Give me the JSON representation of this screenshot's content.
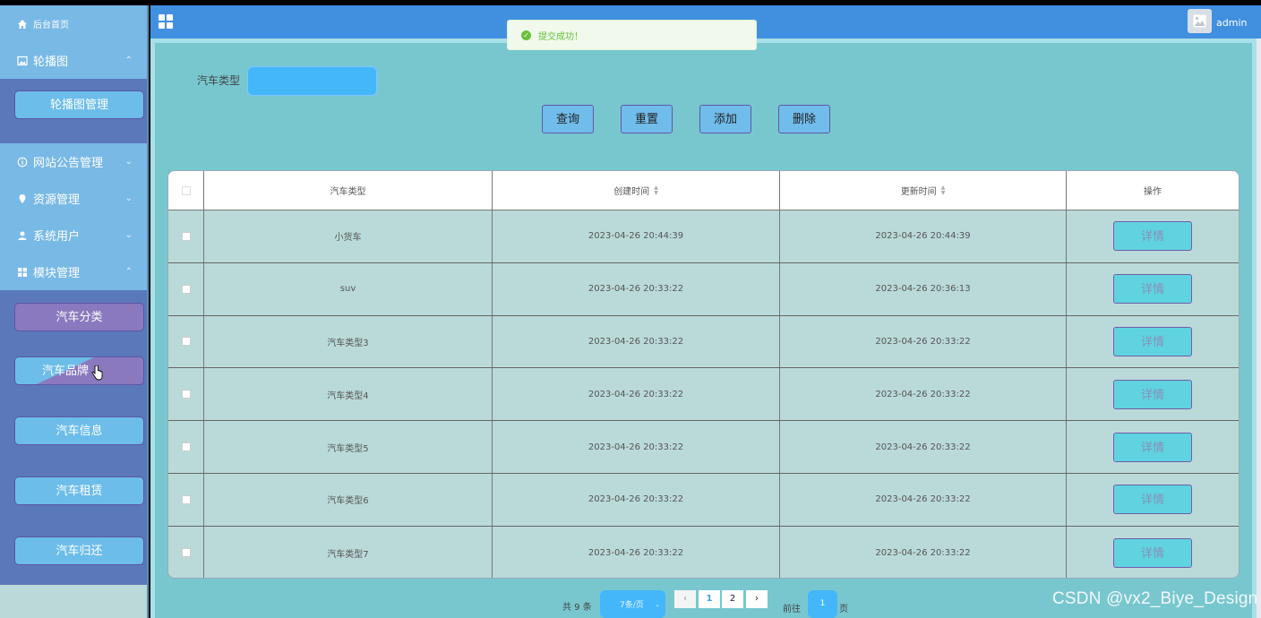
{
  "sidebar": {
    "home": "后台首页",
    "carousel": "轮播图",
    "carousel_manage": "轮播图管理",
    "notice": "网站公告管理",
    "resource": "资源管理",
    "users": "系统用户",
    "modules": "模块管理",
    "module_items": [
      "汽车分类",
      "汽车品牌",
      "汽车信息",
      "汽车租赁",
      "汽车归还"
    ]
  },
  "header": {
    "title": "",
    "user": "admin"
  },
  "toast": {
    "message": "提交成功！"
  },
  "filter": {
    "label": "汽车类型",
    "value": ""
  },
  "actions": {
    "query": "查询",
    "reset": "重置",
    "add": "添加",
    "delete": "删除"
  },
  "table": {
    "columns": [
      "汽车类型",
      "创建时间",
      "更新时间",
      "操作"
    ],
    "rows": [
      {
        "type": "小货车",
        "created": "2023-04-26 20:44:39",
        "updated": "2023-04-26 20:44:39",
        "action": "详情"
      },
      {
        "type": "suv",
        "created": "2023-04-26 20:33:22",
        "updated": "2023-04-26 20:36:13",
        "action": "详情"
      },
      {
        "type": "汽车类型3",
        "created": "2023-04-26 20:33:22",
        "updated": "2023-04-26 20:33:22",
        "action": "详情"
      },
      {
        "type": "汽车类型4",
        "created": "2023-04-26 20:33:22",
        "updated": "2023-04-26 20:33:22",
        "action": "详情"
      },
      {
        "type": "汽车类型5",
        "created": "2023-04-26 20:33:22",
        "updated": "2023-04-26 20:33:22",
        "action": "详情"
      },
      {
        "type": "汽车类型6",
        "created": "2023-04-26 20:33:22",
        "updated": "2023-04-26 20:33:22",
        "action": "详情"
      },
      {
        "type": "汽车类型7",
        "created": "2023-04-26 20:33:22",
        "updated": "2023-04-26 20:33:22",
        "action": "详情"
      }
    ]
  },
  "pagination": {
    "total": "共 9 条",
    "page_size": "7条/页",
    "pages": [
      "1",
      "2"
    ],
    "current": "1",
    "goto_label": "前往",
    "goto_value": "1",
    "goto_suffix": "页"
  },
  "watermark": "CSDN @vx2_Biye_Design",
  "colors": {
    "topbar": "#4190e0",
    "sidebar_top": "#79b9e6",
    "sidebar_sub": "#5b78bb",
    "panel": "#78c7cf",
    "button": "#70bcea",
    "detail_button": "#5fd3df",
    "toast_success": "#67c23a"
  }
}
